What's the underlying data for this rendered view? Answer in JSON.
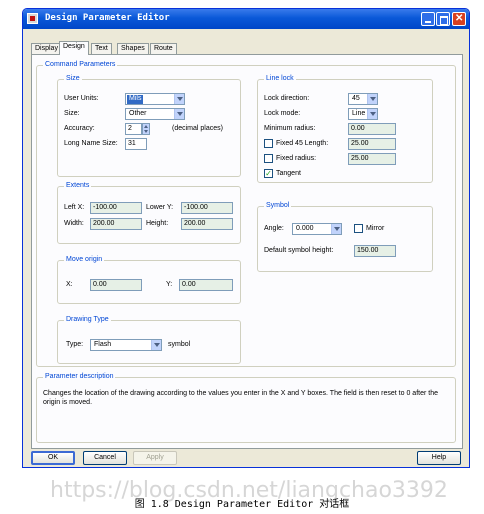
{
  "window": {
    "title": "Design Parameter Editor"
  },
  "tabs": [
    "Display",
    "Design",
    "Text",
    "Shapes",
    "Route"
  ],
  "active_tab": "Design",
  "command_parameters": {
    "title": "Command Parameters",
    "size": {
      "title": "Size",
      "user_units_label": "User Units:",
      "user_units_value": "Mils",
      "size_label": "Size:",
      "size_value": "Other",
      "accuracy_label": "Accuracy:",
      "accuracy_value": "2",
      "accuracy_suffix": "(decimal places)",
      "long_name_size_label": "Long Name Size:",
      "long_name_size_value": "31"
    },
    "extents": {
      "title": "Extents",
      "left_x_label": "Left X:",
      "left_x_value": "-100.00",
      "lower_y_label": "Lower Y:",
      "lower_y_value": "-100.00",
      "width_label": "Width:",
      "width_value": "200.00",
      "height_label": "Height:",
      "height_value": "200.00"
    },
    "move_origin": {
      "title": "Move origin",
      "x_label": "X:",
      "x_value": "0.00",
      "y_label": "Y:",
      "y_value": "0.00"
    },
    "drawing_type": {
      "title": "Drawing Type",
      "type_label": "Type:",
      "type_value": "Flash",
      "suffix": "symbol"
    },
    "line_lock": {
      "title": "Line lock",
      "lock_direction_label": "Lock direction:",
      "lock_direction_value": "45",
      "lock_mode_label": "Lock mode:",
      "lock_mode_value": "Line",
      "min_radius_label": "Minimum radius:",
      "min_radius_value": "0.00",
      "fixed45_label": "Fixed 45 Length:",
      "fixed45_checked": false,
      "fixed45_value": "25.00",
      "fixed_radius_label": "Fixed radius:",
      "fixed_radius_checked": false,
      "fixed_radius_value": "25.00",
      "tangent_label": "Tangent",
      "tangent_checked": true,
      "check_mark": "✓"
    },
    "symbol": {
      "title": "Symbol",
      "angle_label": "Angle:",
      "angle_value": "0.000",
      "mirror_label": "Mirror",
      "mirror_checked": false,
      "default_height_label": "Default symbol height:",
      "default_height_value": "150.00"
    }
  },
  "parameter_description": {
    "title": "Parameter description",
    "text": "Changes the location of the drawing according to the values you enter in the X and Y boxes. The field is then reset to 0 after the origin is moved."
  },
  "buttons": {
    "ok": "OK",
    "cancel": "Cancel",
    "apply": "Apply",
    "help": "Help"
  },
  "watermark": "https://blog.csdn.net/liangchao3392",
  "caption": "图 1.8 Design Parameter Editor 对话框",
  "colors": {
    "titlebar": "#0a58d8",
    "group_title": "#0046d5",
    "selection": "#316ac5",
    "readonly_field": "#e6f0e6"
  }
}
